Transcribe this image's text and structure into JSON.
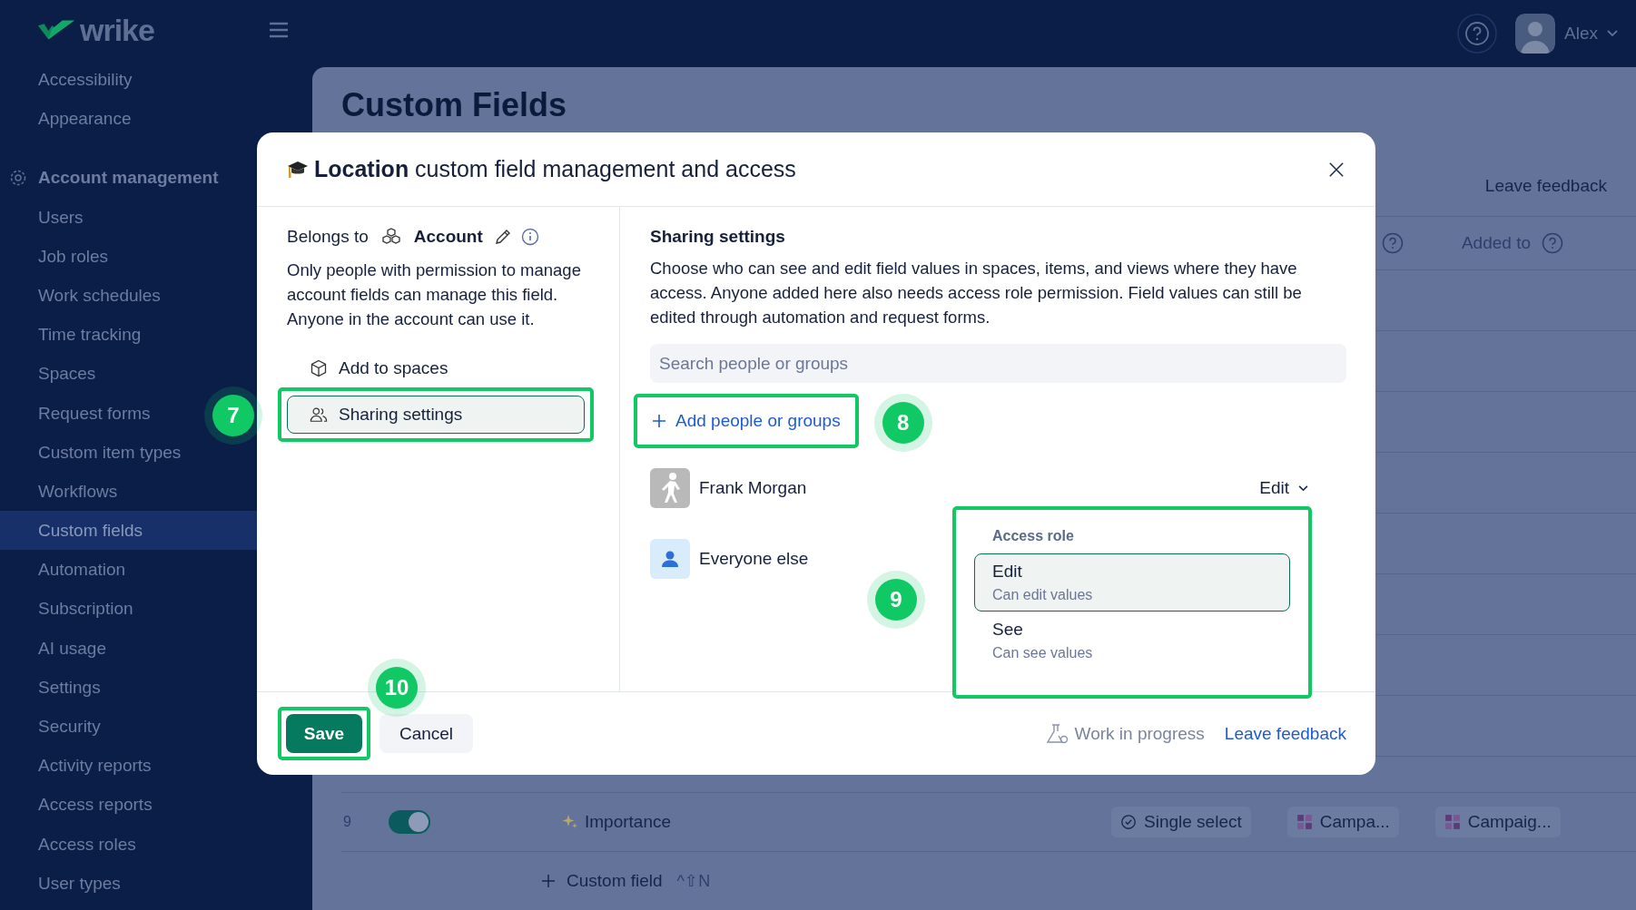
{
  "app": {
    "logo": "wrike",
    "user": "Alex"
  },
  "sidebar": {
    "items": [
      {
        "label": "Accessibility",
        "kind": "link",
        "selected": false
      },
      {
        "label": "Appearance",
        "kind": "link",
        "selected": false
      },
      {
        "label": "Account management",
        "kind": "section",
        "selected": false
      },
      {
        "label": "Users",
        "kind": "link",
        "selected": false
      },
      {
        "label": "Job roles",
        "kind": "link",
        "selected": false
      },
      {
        "label": "Work schedules",
        "kind": "link",
        "selected": false
      },
      {
        "label": "Time tracking",
        "kind": "link",
        "selected": false
      },
      {
        "label": "Spaces",
        "kind": "link",
        "selected": false
      },
      {
        "label": "Request forms",
        "kind": "link",
        "selected": false
      },
      {
        "label": "Custom item types",
        "kind": "link",
        "selected": false
      },
      {
        "label": "Workflows",
        "kind": "link",
        "selected": false
      },
      {
        "label": "Custom fields",
        "kind": "link",
        "selected": true
      },
      {
        "label": "Automation",
        "kind": "link",
        "selected": false
      },
      {
        "label": "Subscription",
        "kind": "link",
        "selected": false
      },
      {
        "label": "AI usage",
        "kind": "link",
        "selected": false
      },
      {
        "label": "Settings",
        "kind": "link",
        "selected": false
      },
      {
        "label": "Security",
        "kind": "link",
        "selected": false
      },
      {
        "label": "Activity reports",
        "kind": "link",
        "selected": false
      },
      {
        "label": "Access reports",
        "kind": "link",
        "selected": false
      },
      {
        "label": "Access roles",
        "kind": "link",
        "selected": false
      },
      {
        "label": "User types",
        "kind": "link",
        "selected": false
      }
    ]
  },
  "page": {
    "title": "Custom Fields",
    "feedback": "Leave feedback",
    "column": "Added to",
    "row": {
      "number": "9",
      "on": true,
      "name": "Importance",
      "type": "Single select",
      "tag_1": "Campa...",
      "tag_2": "Campaig..."
    },
    "add": {
      "label": "Custom field",
      "shortcut": "^⇧N"
    }
  },
  "dialog": {
    "title": "**Location** custom field management and access",
    "belongs_label": "Belongs to",
    "belongs_value": "Account",
    "description": "Only people with permission to manage account fields can manage this field. Anyone in the account can use it.",
    "nav": [
      {
        "label": "Add to spaces",
        "selected": false
      },
      {
        "label": "Sharing settings",
        "selected": true,
        "callout": "7"
      }
    ],
    "sharing": {
      "heading": "Sharing settings",
      "description": "Choose who can see and edit field values in spaces, items, and views where they have access. Anyone added here also needs access role permission. Field values can still be edited through automation and request forms.",
      "search_placeholder": "Search people or groups",
      "add_button": "Add people or groups",
      "add_callout": "8"
    },
    "members": [
      {
        "name": "Frank Morgan",
        "kind": "person",
        "role": "Edit"
      },
      {
        "name": "Everyone else",
        "kind": "group"
      }
    ],
    "role_menu": {
      "heading": "Access role",
      "callout": "9",
      "options": [
        {
          "label": "Edit",
          "hint": "Can edit values",
          "selected": true
        },
        {
          "label": "See",
          "hint": "Can see values",
          "selected": false
        }
      ]
    },
    "footer": {
      "save": "Save",
      "save_callout": "10",
      "cancel": "Cancel",
      "status": "Work in progress",
      "feedback": "Leave feedback"
    }
  }
}
